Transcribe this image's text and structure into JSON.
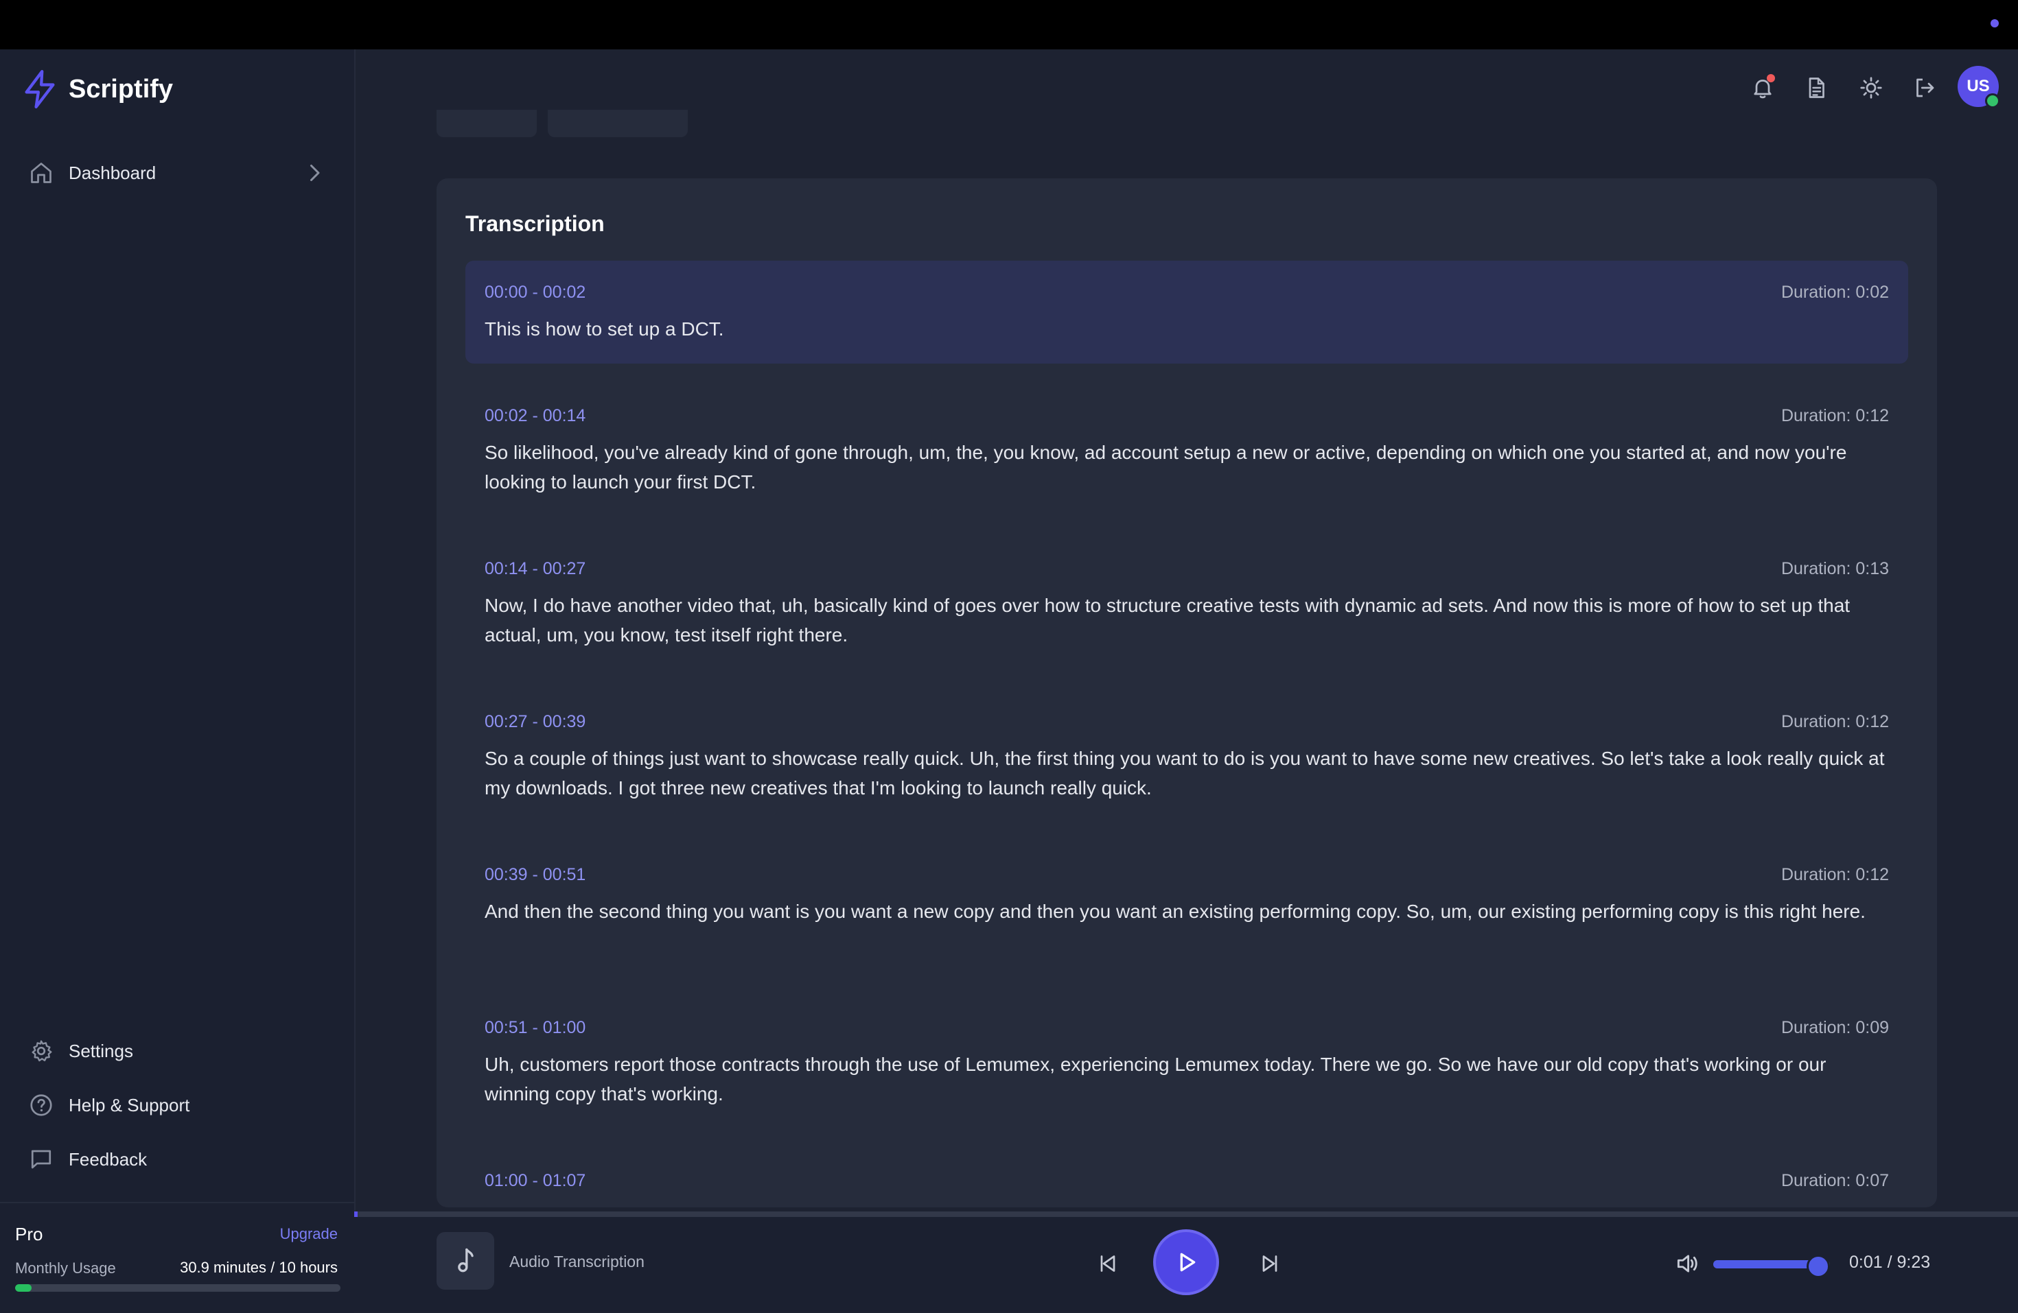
{
  "app": {
    "name": "Scriptify",
    "accent": "#5b52f0"
  },
  "sidebar": {
    "nav": [
      {
        "label": "Dashboard",
        "icon": "home-icon"
      }
    ],
    "bottom": [
      {
        "label": "Settings",
        "icon": "gear-icon"
      },
      {
        "label": "Help & Support",
        "icon": "help-circle-icon"
      },
      {
        "label": "Feedback",
        "icon": "message-square-icon"
      }
    ],
    "plan": {
      "tier": "Pro",
      "upgrade_label": "Upgrade",
      "usage_label": "Monthly Usage",
      "usage_value": "30.9 minutes / 10 hours",
      "usage_fraction": 0.05
    }
  },
  "header": {
    "icons": [
      "bell-icon",
      "document-icon",
      "sun-icon",
      "logout-icon"
    ],
    "user_initials": "US"
  },
  "transcription": {
    "title": "Transcription",
    "segments": [
      {
        "range": "00:00 - 00:02",
        "duration": "Duration: 0:02",
        "text": "This is how to set up a DCT.",
        "active": true
      },
      {
        "range": "00:02 - 00:14",
        "duration": "Duration: 0:12",
        "text": "So likelihood, you've already kind of gone through, um, the, you know, ad account setup a new or active, depending on which one you started at, and now you're looking to launch your first DCT."
      },
      {
        "range": "00:14 - 00:27",
        "duration": "Duration: 0:13",
        "text": "Now, I do have another video that, uh, basically kind of goes over how to structure creative tests with dynamic ad sets. And now this is more of how to set up that actual, um, you know, test itself right there."
      },
      {
        "range": "00:27 - 00:39",
        "duration": "Duration: 0:12",
        "text": "So a couple of things just want to showcase really quick. Uh, the first thing you want to do is you want to have some new creatives. So let's take a look really quick at my downloads. I got three new creatives that I'm looking to launch really quick."
      },
      {
        "range": "00:39 - 00:51",
        "duration": "Duration: 0:12",
        "text": "And then the second thing you want is you want a new copy and then you want an existing performing copy. So, um, our existing performing copy is this right here."
      },
      {
        "range": "00:51 - 01:00",
        "duration": "Duration: 0:09",
        "text": "Uh, customers report those contracts through the use of Lemumex, experiencing Lemumex today. There we go. So we have our old copy that's working or our winning copy that's working."
      },
      {
        "range": "01:00 - 01:07",
        "duration": "Duration: 0:07",
        "text": ""
      }
    ]
  },
  "player": {
    "track_title": "Audio Transcription",
    "time": "0:01 / 9:23",
    "progress_fraction": 0.0018,
    "volume_fraction": 0.9,
    "thumb_icon": "music-note-icon"
  }
}
